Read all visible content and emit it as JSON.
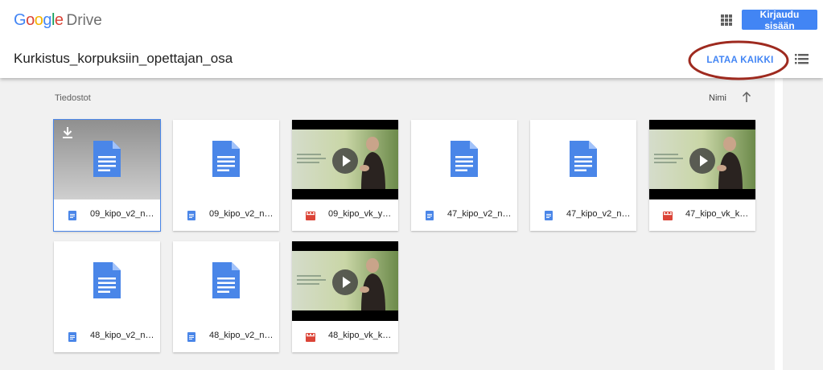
{
  "header": {
    "logo_google": "Google",
    "logo_drive": "Drive",
    "signin_label": "Kirjaudu sisään",
    "folder_title": "Kurkistus_korpuksiin_opettajan_osa",
    "download_all_label": "LATAA KAIKKI"
  },
  "content": {
    "section_label": "Tiedostot",
    "sort_label": "Nimi"
  },
  "colors": {
    "accent": "#4285f4",
    "doc_blue": "#4a86e8",
    "video_red": "#db4437",
    "highlight_ring": "#9e2a1f"
  },
  "files": [
    {
      "name": "09_kipo_v2_ne…",
      "type": "doc",
      "selected": true
    },
    {
      "name": "09_kipo_v2_ne…",
      "type": "doc"
    },
    {
      "name": "09_kipo_vk_yh…",
      "type": "video"
    },
    {
      "name": "47_kipo_v2_ne…",
      "type": "doc"
    },
    {
      "name": "47_kipo_v2_ne…",
      "type": "doc"
    },
    {
      "name": "47_kipo_vk_ka…",
      "type": "video"
    },
    {
      "name": "48_kipo_v2_ne…",
      "type": "doc"
    },
    {
      "name": "48_kipo_v2_ne…",
      "type": "doc"
    },
    {
      "name": "48_kipo_vk_ka…",
      "type": "video"
    }
  ]
}
